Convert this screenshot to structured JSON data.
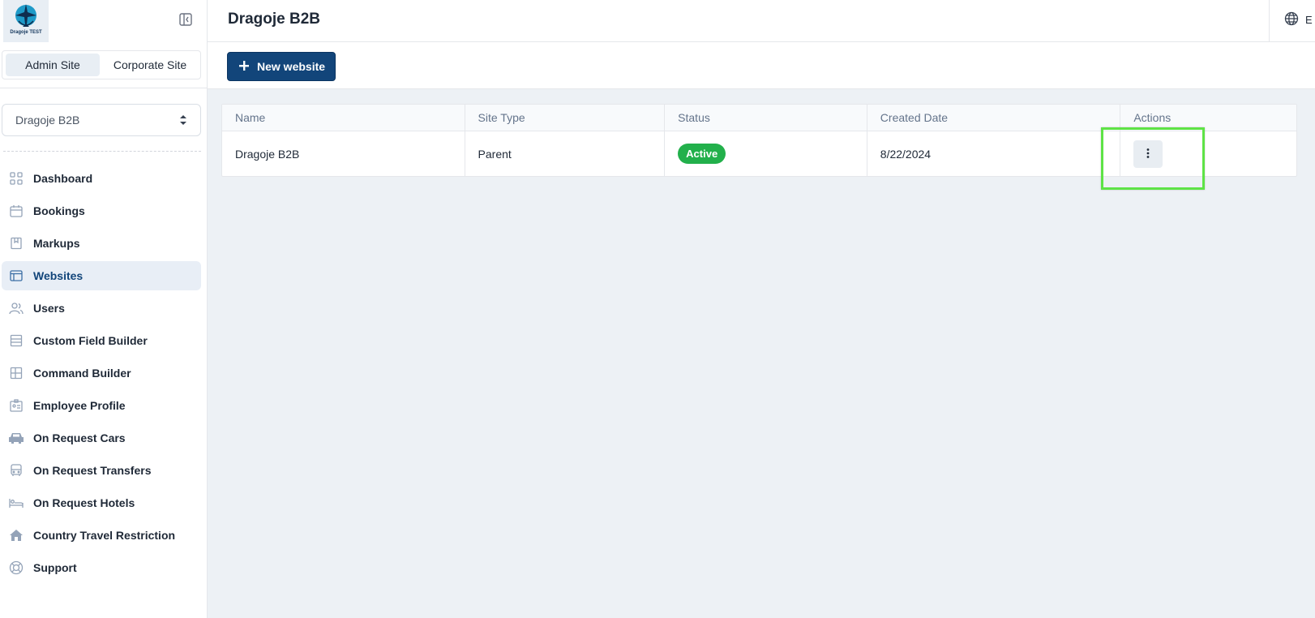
{
  "logo": {
    "text": "Dragoje TEST"
  },
  "site_switch": {
    "options": [
      "Admin Site",
      "Corporate Site"
    ],
    "active": "Admin Site"
  },
  "site_select": {
    "value": "Dragoje B2B"
  },
  "nav": {
    "items": [
      {
        "label": "Dashboard",
        "icon": "dashboard-icon"
      },
      {
        "label": "Bookings",
        "icon": "calendar-icon"
      },
      {
        "label": "Markups",
        "icon": "bookmark-icon"
      },
      {
        "label": "Websites",
        "icon": "browser-window-icon",
        "active": true
      },
      {
        "label": "Users",
        "icon": "users-icon"
      },
      {
        "label": "Custom Field Builder",
        "icon": "list-icon"
      },
      {
        "label": "Command Builder",
        "icon": "layout-icon"
      },
      {
        "label": "Employee Profile",
        "icon": "id-card-icon"
      },
      {
        "label": "On Request Cars",
        "icon": "car-icon"
      },
      {
        "label": "On Request Transfers",
        "icon": "bus-icon"
      },
      {
        "label": "On Request Hotels",
        "icon": "bed-icon"
      },
      {
        "label": "Country Travel Restriction",
        "icon": "home-icon"
      },
      {
        "label": "Support",
        "icon": "lifebuoy-icon"
      }
    ]
  },
  "header": {
    "title": "Dragoje B2B",
    "language": "E"
  },
  "toolbar": {
    "new_website_label": "New website"
  },
  "table": {
    "columns": [
      "Name",
      "Site Type",
      "Status",
      "Created Date",
      "Actions"
    ],
    "rows": [
      {
        "name": "Dragoje B2B",
        "site_type": "Parent",
        "status": "Active",
        "created_date": "8/22/2024"
      }
    ]
  },
  "colors": {
    "primary": "#12457a",
    "active_badge": "#22b04b",
    "highlight": "#5ee346",
    "content_bg": "#edf1f5"
  }
}
